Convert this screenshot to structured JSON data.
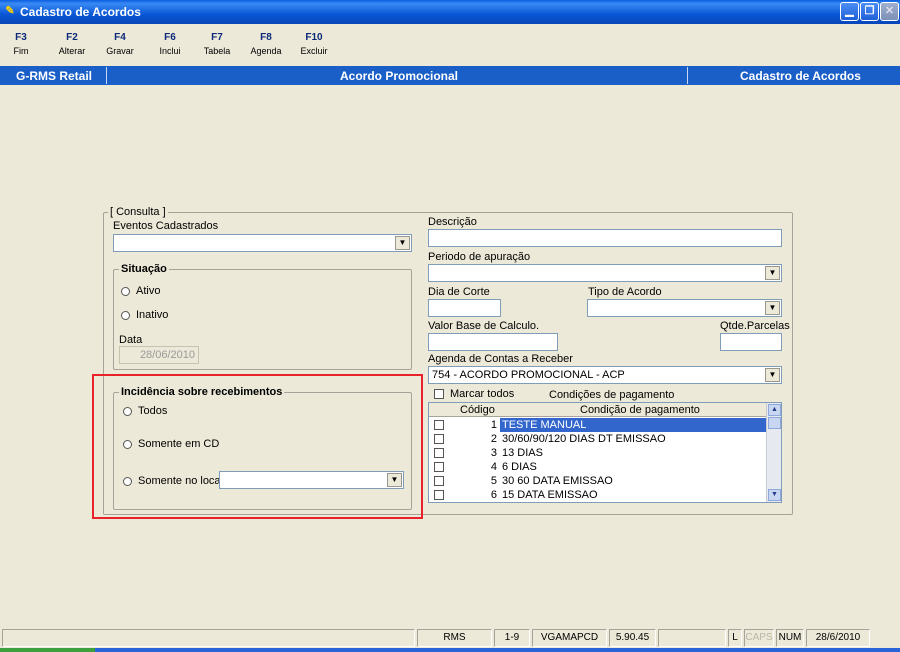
{
  "window": {
    "title": "Cadastro de Acordos"
  },
  "fkeys": [
    {
      "key": "F3",
      "label": "Fim"
    },
    {
      "key": "F2",
      "label": "Alterar"
    },
    {
      "key": "F4",
      "label": "Gravar"
    },
    {
      "key": "F6",
      "label": "Inclui"
    },
    {
      "key": "F7",
      "label": "Tabela"
    },
    {
      "key": "F8",
      "label": "Agenda"
    },
    {
      "key": "F10",
      "label": "Excluir"
    }
  ],
  "infobar": {
    "left": "G-RMS Retail",
    "center": "Acordo Promocional",
    "right": "Cadastro de Acordos"
  },
  "consulta": {
    "group_label": "[ Consulta ]",
    "eventos_label": "Eventos Cadastrados",
    "eventos_value": "",
    "situacao": {
      "label": "Situação",
      "ativo": "Ativo",
      "inativo": "Inativo",
      "data_label": "Data",
      "data_value": "28/06/2010"
    },
    "incidencia": {
      "label": "Incidência sobre recebimentos",
      "todos": "Todos",
      "somente_cd": "Somente em CD",
      "somente_local": "Somente no local",
      "local_value": ""
    }
  },
  "form": {
    "descricao_label": "Descrição",
    "descricao_value": "",
    "periodo_label": "Periodo de apuração",
    "periodo_value": "",
    "dia_corte_label": "Dia de Corte",
    "dia_corte_value": "",
    "tipo_acordo_label": "Tipo de Acordo",
    "tipo_acordo_value": "",
    "valor_base_label": "Valor Base de Calculo.",
    "valor_base_value": "",
    "qtde_parcelas_label": "Qtde.Parcelas",
    "qtde_parcelas_value": "",
    "agenda_label": "Agenda de Contas a Receber",
    "agenda_value": "754 - ACORDO PROMOCIONAL - ACP",
    "marcar_todos": "Marcar todos",
    "condicoes_label": "Condições de pagamento"
  },
  "grid": {
    "headers": [
      "Código",
      "Condição de pagamento"
    ],
    "rows": [
      {
        "code": "1",
        "desc": "TESTE MANUAL",
        "selected": true
      },
      {
        "code": "2",
        "desc": "30/60/90/120 DIAS DT EMISSAO",
        "selected": false
      },
      {
        "code": "3",
        "desc": "13 DIAS",
        "selected": false
      },
      {
        "code": "4",
        "desc": "6 DIAS",
        "selected": false
      },
      {
        "code": "5",
        "desc": "30 60 DATA EMISSAO",
        "selected": false
      },
      {
        "code": "6",
        "desc": "15 DATA EMISSAO",
        "selected": false
      }
    ]
  },
  "statusbar": {
    "app": "RMS",
    "range": "1-9",
    "user": "VGAMAPCD",
    "version": "5.90.45",
    "l": "L",
    "caps": "CAPS",
    "num": "NUM",
    "date": "28/6/2010"
  },
  "colors": {
    "titlebar": "#0a57d6",
    "infobar": "#1a5fc7",
    "highlight": "#e8212a",
    "selected_row": "#3366cc"
  }
}
